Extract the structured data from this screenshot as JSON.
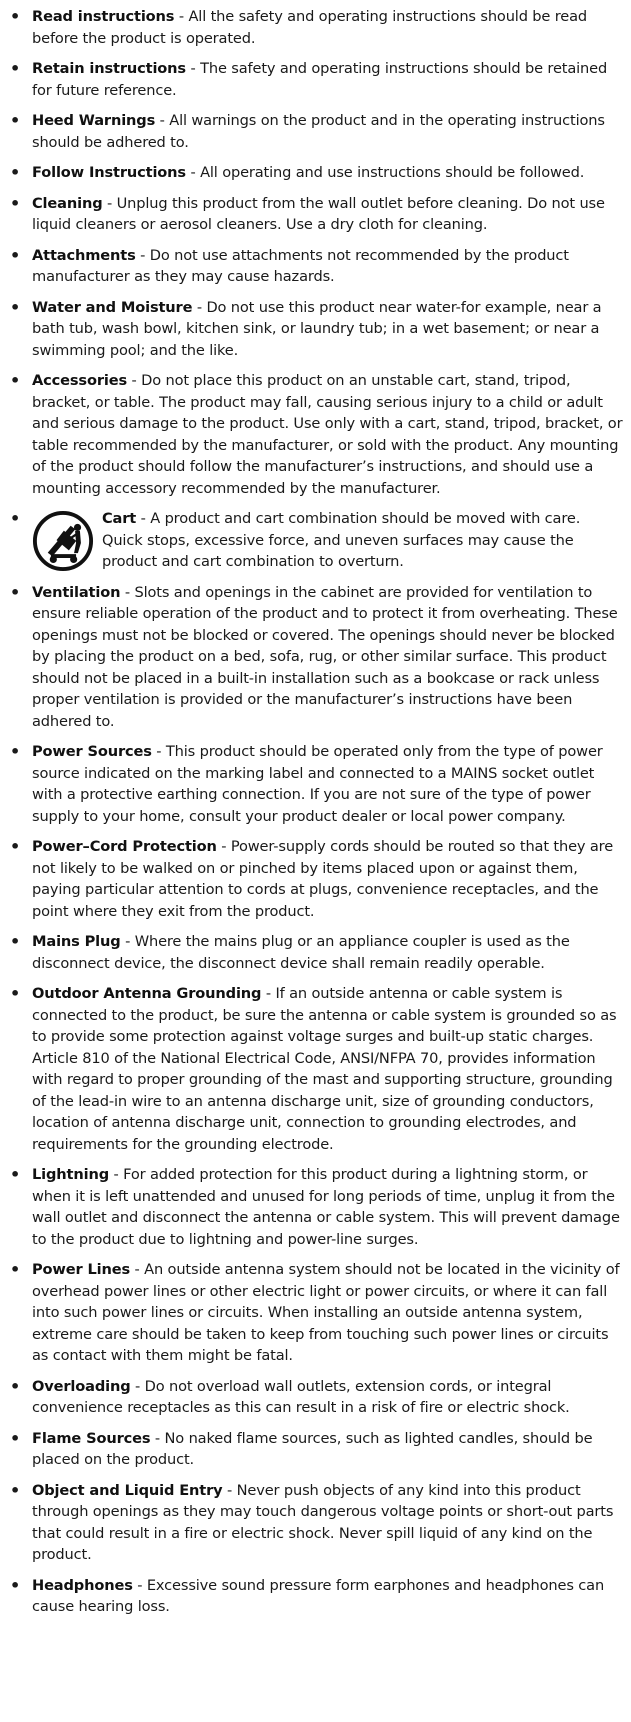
{
  "items": [
    {
      "term": "Read instructions",
      "text": "All the safety and operating instructions should be read before the product is operated."
    },
    {
      "term": "Retain instructions",
      "text": "The safety and operating instructions should be retained for future reference."
    },
    {
      "term": "Heed Warnings",
      "text": "All warnings on the product and in the operating instructions should be adhered to."
    },
    {
      "term": "Follow Instructions",
      "text": "All operating and use instructions should be followed."
    },
    {
      "term": "Cleaning",
      "text": "Unplug this product from the wall outlet before cleaning. Do not use liquid cleaners or aerosol cleaners. Use a dry cloth for cleaning."
    },
    {
      "term": "Attachments",
      "text": "Do not use attachments not recommended by the product manufacturer as they may cause hazards."
    },
    {
      "term": "Water and Moisture",
      "text": "Do not use this product near water-for example, near a bath tub, wash bowl, kitchen sink, or laundry tub; in a wet basement; or near a swimming pool; and the like."
    },
    {
      "term": "Accessories",
      "text": "Do not place this product on an unstable cart, stand, tripod, bracket, or table. The product may fall, causing serious injury to a child or adult and serious damage to the product. Use only with a cart, stand, tripod, bracket, or table recommended by the manufacturer, or sold with the product. Any mounting of the product should follow the manufacturer’s instructions, and should use a mounting accessory recommended by the manufacturer."
    },
    {
      "term": "Cart",
      "text": "A product and cart combination should be moved with care. Quick stops, excessive force, and uneven surfaces may cause the product and cart combination to overturn.",
      "icon": "cart-tipping-warning-icon"
    },
    {
      "term": "Ventilation",
      "text": "Slots and openings in the cabinet are provided for ventilation to ensure reliable operation of the product and to protect it from overheating. These openings must not be blocked or covered. The openings should never be blocked by placing the product on a bed, sofa, rug, or other similar surface. This product should not be placed in a built-in installation such as a bookcase or rack unless proper ventilation is provided or the manufacturer’s instructions have been adhered to."
    },
    {
      "term": "Power Sources",
      "text": "This product should be operated only from the type of power source indicated on the marking label and connected to a MAINS socket outlet with a protective earthing connection. If you are not sure of the type of power supply to your home, consult your product dealer or local power company."
    },
    {
      "term": "Power–Cord Protection",
      "text": "Power-supply cords should be routed so that they are not likely to be walked on or pinched by items placed upon or against them, paying particular attention to cords at plugs, convenience receptacles, and the point where they exit from the product."
    },
    {
      "term": "Mains Plug",
      "text": "Where the mains plug or an appliance coupler is used as the disconnect device, the disconnect device shall remain readily operable."
    },
    {
      "term": "Outdoor Antenna Grounding",
      "text": "If an outside antenna or cable system is connected to the product, be sure the antenna or cable system is grounded so as to provide some protection against voltage surges and built-up static charges. Article 810 of the National Electrical Code, ANSI/NFPA 70, provides information with regard to proper grounding of the mast and supporting structure, grounding of the lead-in wire to an antenna discharge unit, size of grounding conductors, location of antenna discharge unit, connection to grounding electrodes, and requirements for the grounding electrode."
    },
    {
      "term": "Lightning",
      "text": "For added protection for this product during a lightning storm, or when it is left unattended and unused for long periods of time, unplug it from the wall outlet and disconnect the antenna or cable system. This will prevent damage to the product due to lightning and power-line surges."
    },
    {
      "term": "Power Lines",
      "text": "An outside antenna system should not be located in the vicinity of overhead power lines or other electric light or power circuits, or where it can fall into such power lines or circuits. When installing an outside antenna system, extreme care should be taken to keep from touching such power lines or circuits as contact with them might be fatal."
    },
    {
      "term": "Overloading",
      "text": "Do not overload wall outlets, extension cords, or integral convenience receptacles as this can result in a risk of fire or electric shock."
    },
    {
      "term": "Flame Sources",
      "text": "No naked flame sources, such as lighted candles, should be placed on the product."
    },
    {
      "term": "Object and Liquid Entry",
      "text": "Never push objects of any kind into this product through openings as they may touch dangerous voltage points or short-out parts that could result in a fire or electric shock. Never spill liquid of any kind on the product."
    },
    {
      "term": "Headphones",
      "text": "Excessive sound pressure form earphones and headphones can cause hearing loss."
    }
  ],
  "separator": " - ",
  "bullet": "•"
}
